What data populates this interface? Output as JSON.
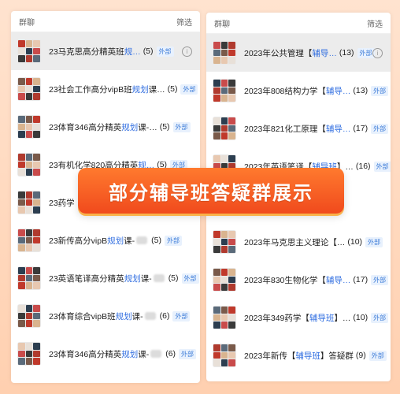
{
  "left_panel": {
    "header_title": "群聊",
    "header_action": "筛选",
    "rows": [
      {
        "pre": "23马克思高分精英班",
        "kw": "规…",
        "post": "",
        "blur": false,
        "count": "(5)",
        "badge": "外部"
      },
      {
        "pre": "23社会工作高分vipB班",
        "kw": "规划",
        "post": "课…",
        "blur": false,
        "count": "(5)",
        "badge": "外部"
      },
      {
        "pre": "23体育346高分精英",
        "kw": "规划",
        "post": "课-…",
        "blur": false,
        "count": "(5)",
        "badge": "外部"
      },
      {
        "pre": "23有机化学820高分精英",
        "kw": "规…",
        "post": "",
        "blur": false,
        "count": "(5)",
        "badge": "外部"
      },
      {
        "pre": "23药学",
        "kw": "",
        "post": "",
        "blur": false,
        "count": "",
        "badge": ""
      },
      {
        "pre": "23新传高分vipB",
        "kw": "规划",
        "post": "课-",
        "blur": true,
        "count": "(5)",
        "badge": "外部"
      },
      {
        "pre": "23英语笔译高分精英",
        "kw": "规划",
        "post": "课-",
        "blur": true,
        "count": "(5)",
        "badge": "外部"
      },
      {
        "pre": "23体育综合vipB班",
        "kw": "规划",
        "post": "课-",
        "blur": true,
        "count": "(6)",
        "badge": "外部"
      },
      {
        "pre": "23体育346高分精英",
        "kw": "规划",
        "post": "课-",
        "blur": true,
        "count": "(6)",
        "badge": "外部"
      }
    ]
  },
  "right_panel": {
    "header_title": "群聊",
    "header_action": "筛选",
    "rows": [
      {
        "pre": "2023年公共管理【",
        "kw": "辅导…",
        "post": "",
        "count": "(13)",
        "badge": "外部"
      },
      {
        "pre": "2023年808结构力学【",
        "kw": "辅导…",
        "post": "",
        "count": "(13)",
        "badge": "外部"
      },
      {
        "pre": "2023年821化工原理【",
        "kw": "辅导…",
        "post": "",
        "count": "(17)",
        "badge": "外部"
      },
      {
        "pre": "2023年英语笔译【",
        "kw": "辅导班",
        "post": "】…",
        "count": "(16)",
        "badge": "外部"
      },
      {
        "pre": "",
        "kw": "",
        "post": "",
        "count": "(14)",
        "badge": "外部"
      },
      {
        "pre": "2023年马克思主义理论【…",
        "kw": "",
        "post": "",
        "count": "(10)",
        "badge": "外部"
      },
      {
        "pre": "2023年830生物化学【",
        "kw": "辅导…",
        "post": "",
        "count": "(17)",
        "badge": "外部"
      },
      {
        "pre": "2023年349药学【",
        "kw": "辅导班",
        "post": "】…",
        "count": "(10)",
        "badge": "外部"
      },
      {
        "pre": "2023年新传【",
        "kw": "辅导班",
        "post": "】答疑群",
        "count": "(9)",
        "badge": "外部"
      }
    ]
  },
  "banner": {
    "text": "部分辅导班答疑群展示"
  },
  "icons": {
    "info": "info-icon",
    "avatar": "group-avatar"
  },
  "colors": {
    "keyword": "#2f6de0",
    "banner": "#f04a1d",
    "badge": "#3b7bd8"
  }
}
